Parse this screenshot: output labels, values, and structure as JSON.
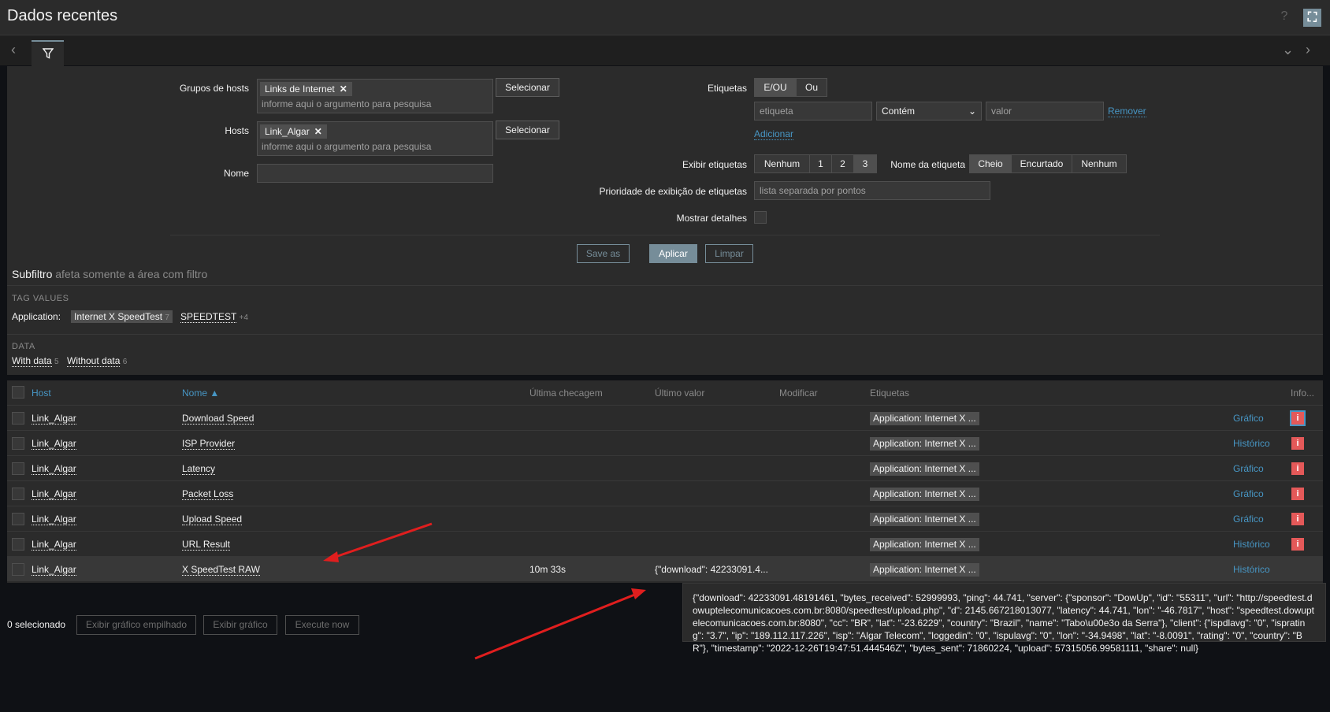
{
  "header": {
    "title": "Dados recentes",
    "help": "?",
    "fullscreen": "⛶"
  },
  "filter": {
    "host_groups_label": "Grupos de hosts",
    "host_groups_chip": "Links de Internet",
    "host_groups_placeholder": "informe aqui o argumento para pesquisa",
    "hosts_label": "Hosts",
    "hosts_chip": "Link_Algar",
    "hosts_placeholder": "informe aqui o argumento para pesquisa",
    "name_label": "Nome",
    "select_label": "Selecionar",
    "tags_label": "Etiquetas",
    "tags_and_or": "E/OU",
    "tags_or": "Ou",
    "tag_placeholder": "etiqueta",
    "tag_operator": "Contém",
    "value_placeholder": "valor",
    "remove": "Remover",
    "add": "Adicionar",
    "show_tags_label": "Exibir etiquetas",
    "show_tags_options": [
      "Nenhum",
      "1",
      "2",
      "3"
    ],
    "tag_name_label": "Nome da etiqueta",
    "tag_name_options": [
      "Cheio",
      "Encurtado",
      "Nenhum"
    ],
    "tag_priority_label": "Prioridade de exibição de etiquetas",
    "tag_priority_placeholder": "lista separada por pontos",
    "show_details_label": "Mostrar detalhes",
    "save_as": "Save as",
    "apply": "Aplicar",
    "reset": "Limpar"
  },
  "subfilter": {
    "title": "Subfiltro",
    "note": "afeta somente a área com filtro",
    "tag_values_title": "TAG VALUES",
    "application_label": "Application:",
    "tag_values": [
      {
        "label": "Internet X SpeedTest",
        "count": "7"
      },
      {
        "label": "SPEEDTEST",
        "count": "+4"
      }
    ],
    "data_title": "DATA",
    "data_values": [
      {
        "label": "With data",
        "count": "5"
      },
      {
        "label": "Without data",
        "count": "6"
      }
    ]
  },
  "table": {
    "headers": {
      "host": "Host",
      "name": "Nome ▲",
      "last_check": "Última checagem",
      "last_value": "Último valor",
      "change": "Modificar",
      "tags": "Etiquetas",
      "info": "Info..."
    },
    "rows": [
      {
        "host": "Link_Algar",
        "name": "Download Speed",
        "last_check": "",
        "last_value": "",
        "tag": "Application: Internet X ...",
        "action": "Gráfico"
      },
      {
        "host": "Link_Algar",
        "name": "ISP Provider",
        "last_check": "",
        "last_value": "",
        "tag": "Application: Internet X ...",
        "action": "Histórico"
      },
      {
        "host": "Link_Algar",
        "name": "Latency",
        "last_check": "",
        "last_value": "",
        "tag": "Application: Internet X ...",
        "action": "Gráfico"
      },
      {
        "host": "Link_Algar",
        "name": "Packet Loss",
        "last_check": "",
        "last_value": "",
        "tag": "Application: Internet X ...",
        "action": "Gráfico"
      },
      {
        "host": "Link_Algar",
        "name": "Upload Speed",
        "last_check": "",
        "last_value": "",
        "tag": "Application: Internet X ...",
        "action": "Gráfico"
      },
      {
        "host": "Link_Algar",
        "name": "URL Result",
        "last_check": "",
        "last_value": "",
        "tag": "Application: Internet X ...",
        "action": "Histórico"
      },
      {
        "host": "Link_Algar",
        "name": "X SpeedTest RAW",
        "last_check": "10m 33s",
        "last_value": "{\"download\": 42233091.4...",
        "tag": "Application: Internet X ...",
        "action": "Histórico"
      }
    ]
  },
  "footer": {
    "selected": "0 selecionado",
    "stacked_graph": "Exibir gráfico empilhado",
    "graph": "Exibir gráfico",
    "execute_now": "Execute now"
  },
  "tooltip": "{\"download\": 42233091.48191461, \"bytes_received\": 52999993, \"ping\": 44.741, \"server\": {\"sponsor\": \"DowUp\", \"id\": \"55311\", \"url\": \"http://speedtest.dowuptelecomunicacoes.com.br:8080/speedtest/upload.php\", \"d\": 2145.667218013077, \"latency\": 44.741, \"lon\": \"-46.7817\", \"host\": \"speedtest.dowuptelecomunicacoes.com.br:8080\", \"cc\": \"BR\", \"lat\": \"-23.6229\", \"country\": \"Brazil\", \"name\": \"Tabo\\u00e3o da Serra\"}, \"client\": {\"ispdlavg\": \"0\", \"isprating\": \"3.7\", \"ip\": \"189.112.117.226\", \"isp\": \"Algar Telecom\", \"loggedin\": \"0\", \"ispulavg\": \"0\", \"lon\": \"-34.9498\", \"lat\": \"-8.0091\", \"rating\": \"0\", \"country\": \"BR\"}, \"timestamp\": \"2022-12-26T19:47:51.444546Z\", \"bytes_sent\": 71860224, \"upload\": 57315056.99581111, \"share\": null}",
  "colors": {
    "accent": "#768d99",
    "link": "#4796c4",
    "alert": "#e45959",
    "arrow": "#e01e1e"
  }
}
